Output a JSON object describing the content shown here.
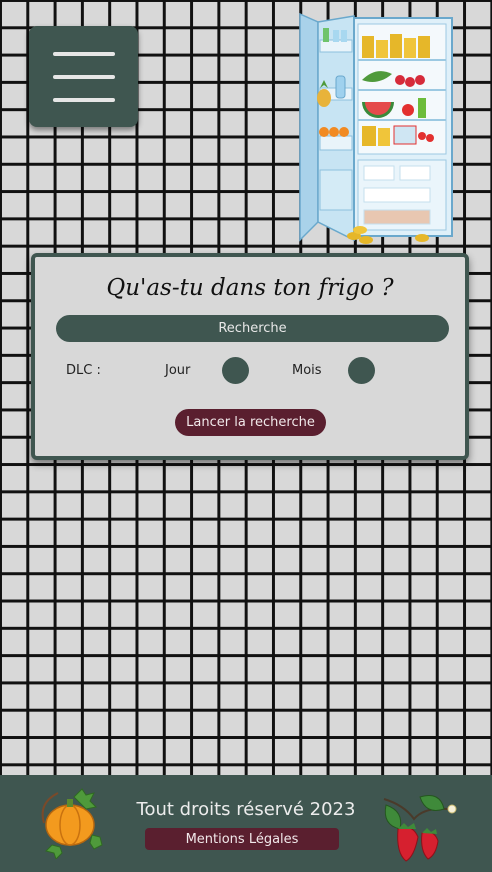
{
  "menu": {
    "icon": "hamburger-menu-icon"
  },
  "illustration": {
    "icon": "open-fridge-icon"
  },
  "search": {
    "title": "Qu'as-tu dans ton frigo ?",
    "placeholder": "Recherche",
    "dlc_label": "DLC :",
    "day_label": "Jour",
    "month_label": "Mois",
    "submit_label": "Lancer la recherche"
  },
  "footer": {
    "copyright": "Tout droits réservé 2023",
    "legal_link": "Mentions Légales",
    "left_icon": "pumpkin-icon",
    "right_icon": "strawberry-icon"
  },
  "colors": {
    "primary": "#3f5650",
    "accent": "#5a1f2f",
    "background": "#d8d8d8",
    "grid": "#111111"
  }
}
